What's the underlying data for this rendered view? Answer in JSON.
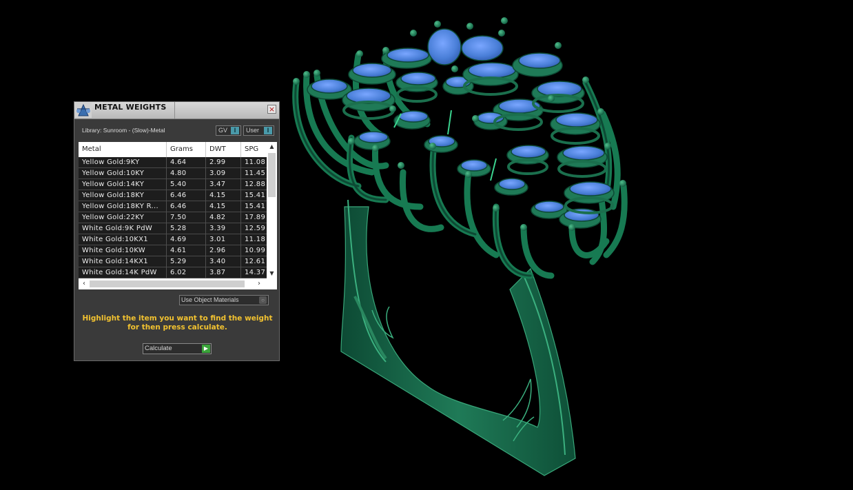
{
  "panel": {
    "title": "METAL WEIGHTS",
    "close_glyph": "×",
    "library_label": "Library: Sunroom - (Slow)-Metal",
    "toggles": [
      {
        "label": "GV",
        "indicator": "I"
      },
      {
        "label": "User",
        "indicator": "I"
      }
    ],
    "table": {
      "headers": [
        "Metal",
        "Grams",
        "DWT",
        "SPG"
      ],
      "rows": [
        {
          "metal": "Yellow Gold:9KY",
          "grams": "4.64",
          "dwt": "2.99",
          "spg": "11.08"
        },
        {
          "metal": "Yellow Gold:10KY",
          "grams": "4.80",
          "dwt": "3.09",
          "spg": "11.45"
        },
        {
          "metal": "Yellow Gold:14KY",
          "grams": "5.40",
          "dwt": "3.47",
          "spg": "12.88"
        },
        {
          "metal": "Yellow Gold:18KY",
          "grams": "6.46",
          "dwt": "4.15",
          "spg": "15.41"
        },
        {
          "metal": "Yellow Gold:18KY R...",
          "grams": "6.46",
          "dwt": "4.15",
          "spg": "15.41"
        },
        {
          "metal": "Yellow Gold:22KY",
          "grams": "7.50",
          "dwt": "4.82",
          "spg": "17.89"
        },
        {
          "metal": "White Gold:9K PdW",
          "grams": "5.28",
          "dwt": "3.39",
          "spg": "12.59"
        },
        {
          "metal": "White Gold:10KX1",
          "grams": "4.69",
          "dwt": "3.01",
          "spg": "11.18"
        },
        {
          "metal": "White Gold:10KW",
          "grams": "4.61",
          "dwt": "2.96",
          "spg": "10.99"
        },
        {
          "metal": "White Gold:14KX1",
          "grams": "5.29",
          "dwt": "3.40",
          "spg": "12.61"
        },
        {
          "metal": "White Gold:14K PdW",
          "grams": "6.02",
          "dwt": "3.87",
          "spg": "14.37"
        }
      ]
    },
    "use_object_materials": "Use Object Materials",
    "instructions": "Highlight the item you want to find the weight for then press calculate.",
    "calculate_label": "Calculate"
  },
  "colors": {
    "background": "#000000",
    "model_metal": "#1f7a57",
    "model_gems": "#4a7fd8",
    "instruction_text": "#f2c230",
    "toggle_indicator": "#4a9aaa"
  },
  "icons": [
    "weight-scale-icon",
    "close-icon",
    "scroll-up-icon",
    "scroll-down-icon",
    "scroll-left-icon",
    "scroll-right-icon",
    "play-arrow-icon"
  ]
}
